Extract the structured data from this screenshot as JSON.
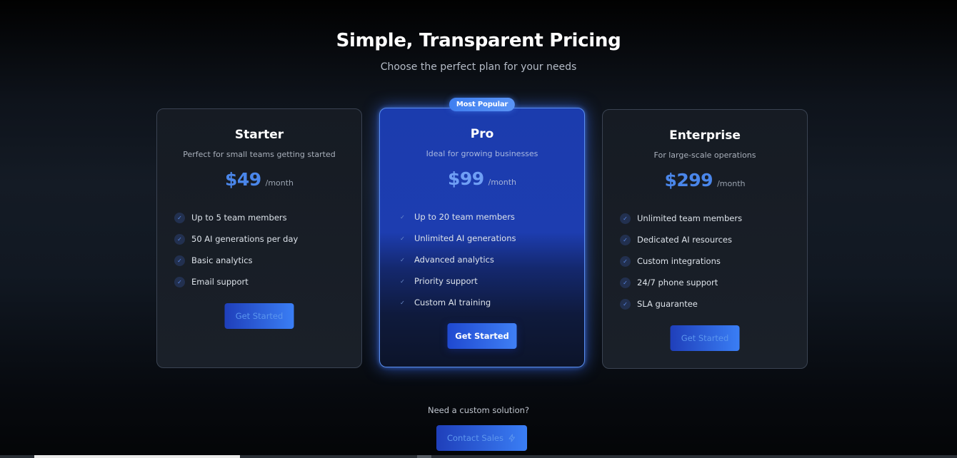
{
  "header": {
    "title": "Simple, Transparent Pricing",
    "subtitle": "Choose the perfect plan for your needs"
  },
  "plans": [
    {
      "name": "Starter",
      "description": "Perfect for small teams getting started",
      "price": "$49",
      "period": "/month",
      "features": [
        "Up to 5 team members",
        "50 AI generations per day",
        "Basic analytics",
        "Email support"
      ],
      "cta": "Get Started"
    },
    {
      "name": "Pro",
      "badge": "Most Popular",
      "description": "Ideal for growing businesses",
      "price": "$99",
      "period": "/month",
      "features": [
        "Up to 20 team members",
        "Unlimited AI generations",
        "Advanced analytics",
        "Priority support",
        "Custom AI training"
      ],
      "cta": "Get Started"
    },
    {
      "name": "Enterprise",
      "description": "For large-scale operations",
      "price": "$299",
      "period": "/month",
      "features": [
        "Unlimited team members",
        "Dedicated AI resources",
        "Custom integrations",
        "24/7 phone support",
        "SLA guarantee"
      ],
      "cta": "Get Started"
    }
  ],
  "footer": {
    "text": "Need a custom solution?",
    "contact_label": "Contact Sales",
    "contact_icon": "lightning-icon"
  },
  "icons": {
    "feature_check": "check-icon"
  },
  "colors": {
    "accent": "#3a7ef5",
    "price": "#4a86ea",
    "pro_background": "#1d3db0",
    "background": "#0e131b"
  }
}
